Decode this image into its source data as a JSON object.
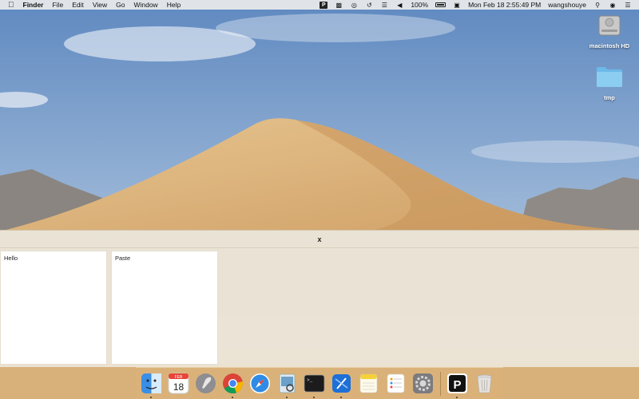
{
  "menubar": {
    "apple": "",
    "app_name": "Finder",
    "menus": [
      "File",
      "Edit",
      "View",
      "Go",
      "Window",
      "Help"
    ],
    "status_icons": [
      "paste-app-icon",
      "chat-bubbles-icon",
      "eye-icon",
      "time-machine-icon",
      "wifi-icon",
      "volume-icon"
    ],
    "battery_percent": "100%",
    "datetime": "Mon Feb 18  2:55:49 PM",
    "username": "wangshouye"
  },
  "desktop": {
    "icons": [
      {
        "label": "macintosh HD",
        "icon": "hard-drive-icon"
      },
      {
        "label": "tmp",
        "icon": "folder-icon"
      }
    ]
  },
  "panel": {
    "close_label": "x",
    "cards": [
      {
        "text": "Hello"
      },
      {
        "text": "Paste"
      }
    ]
  },
  "dock": {
    "calendar_month": "FEB",
    "calendar_day": "18",
    "paste_letter": "P",
    "terminal_prompt": ">_",
    "items": [
      "finder",
      "calendar",
      "launchpad",
      "chrome",
      "safari",
      "preview",
      "terminal",
      "xcode",
      "notes",
      "reminders",
      "system-preferences",
      "paste",
      "trash"
    ]
  },
  "colors": {
    "sky_top": "#6e97c9",
    "sky_bottom": "#c9d6e6",
    "dune": "#d9b27a",
    "dune_shadow": "#b98c52",
    "panel_bg": "#ece4d4",
    "dock_bg": "#dcb478"
  }
}
